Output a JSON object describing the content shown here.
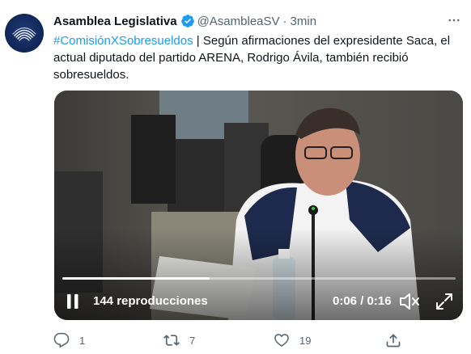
{
  "tweet": {
    "author": {
      "display_name": "Asamblea Legislativa",
      "handle": "@AsambleaSV",
      "time": "3min"
    },
    "text": {
      "hashtag": "#ComisiónXSobresueldos",
      "body": " | Según afirmaciones del expresidente Saca, el actual diputado del partido ARENA, Rodrigo Ávila, también recibió sobresueldos."
    },
    "video": {
      "views": "144 reproducciones",
      "time": "0:06 / 0:16",
      "progress": 0.375
    },
    "actions": {
      "reply_count": "1",
      "retweet_count": "7",
      "like_count": "19"
    }
  },
  "colors": {
    "accent": "#1d9bf0",
    "text": "#0f1419",
    "muted": "#536471",
    "verified": "#1d9bf0"
  },
  "icons": [
    "verified-badge-icon",
    "more-options-icon",
    "pause-icon",
    "mute-icon",
    "fullscreen-icon",
    "reply-icon",
    "retweet-icon",
    "like-icon",
    "share-icon"
  ]
}
